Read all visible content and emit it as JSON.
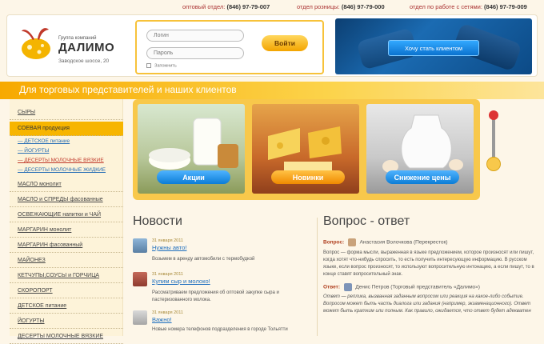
{
  "top_contacts": [
    {
      "label": "оптовый отдел:",
      "phone": "(846) 97-79-007"
    },
    {
      "label": "отдел розницы:",
      "phone": "(846) 97-79-000"
    },
    {
      "label": "отдел по работе с сетями:",
      "phone": "(846) 97-79-009"
    }
  ],
  "logo": {
    "small": "Группа компаний",
    "name": "ДАЛИМО",
    "address": "Заводское шоссе, 20"
  },
  "login": {
    "login_placeholder": "Логин",
    "password_placeholder": "Пароль",
    "remember_label": "Запомнить",
    "submit_label": "Войти"
  },
  "client_button": "Хочу стать клиентом",
  "banner_text": "Для торговых представителей и наших клиентов",
  "sidebar": {
    "items": [
      {
        "label": "СЫРЫ",
        "type": "main"
      },
      {
        "label": "СОЕВАЯ продукция",
        "type": "active"
      },
      {
        "label": "— ДЕТСКОЕ питание",
        "type": "sub"
      },
      {
        "label": "— ЙОГУРТЫ",
        "type": "sub"
      },
      {
        "label": "— ДЕСЕРТЫ МОЛОЧНЫЕ ВЯЗКИЕ",
        "type": "sub-red"
      },
      {
        "label": "— ДЕСЕРТЫ МОЛОЧНЫЕ ЖИДКИЕ",
        "type": "sub"
      },
      {
        "label": "МАСЛО монолит",
        "type": "main"
      },
      {
        "label": "МАСЛО и СПРЕДЫ фасованные",
        "type": "main"
      },
      {
        "label": "ОСВЕЖАЮЩИЕ напитки и ЧАЙ",
        "type": "main"
      },
      {
        "label": "МАРГАРИН монолит",
        "type": "main"
      },
      {
        "label": "МАРГАРИН фасованный",
        "type": "main"
      },
      {
        "label": "МАЙОНЕЗ",
        "type": "main"
      },
      {
        "label": "КЕТЧУПЫ,СОУСЫ и ГОРЧИЦА",
        "type": "main"
      },
      {
        "label": "СКОРОПОРТ",
        "type": "main"
      },
      {
        "label": "ДЕТСКОЕ питание",
        "type": "main"
      },
      {
        "label": "ЙОГУРТЫ",
        "type": "main"
      },
      {
        "label": "ДЕСЕРТЫ МОЛОЧНЫЕ ВЯЗКИЕ",
        "type": "main"
      }
    ]
  },
  "slider": {
    "panels": [
      {
        "label": "Акции",
        "color": "#1e8fe6"
      },
      {
        "label": "Новинки",
        "color": "#f59a00"
      },
      {
        "label": "Снижение цены",
        "color": "#1e8fe6"
      }
    ]
  },
  "news": {
    "heading": "Новости",
    "items": [
      {
        "date": "31 января 2011",
        "title": "Нужны авто!",
        "text": "Возьмем в аренду автомобили с термобудкой"
      },
      {
        "date": "31 января 2011",
        "title": "Купим сыр и молоко!",
        "text": "Рассматриваем предложения об оптовой закупке сыра и пастеризованного молока."
      },
      {
        "date": "31 января 2011",
        "title": "Важно!",
        "text": "Новые номера телефонов подразделения в городе Тольятти"
      }
    ]
  },
  "qa": {
    "heading": "Вопрос - ответ",
    "question_label": "Вопрос:",
    "question_author": "Анастасия Волочкова (Перекресток)",
    "question_text": "Вопрос — форма мысли, выраженная в языке предложением, которое произносят или пишут, когда хотят что-нибудь спросить, то есть получить интересующую информацию. В русском языке, если вопрос произносят, то используют вопросительную интонацию, а если пишут, то в конце ставят вопросительный знак.",
    "answer_label": "Ответ:",
    "answer_author": "Денис Петров (Торговый представитель «Далимо»)",
    "answer_text": "Ответ — реплика, вызванная заданным вопросом или реакция на какое-либо событие. Вопросом может быть часть диалога или задания (например, экзаменационного). Ответ может быть кратким или полным. Как правило, ожидается, что ответ будет адекватен"
  }
}
